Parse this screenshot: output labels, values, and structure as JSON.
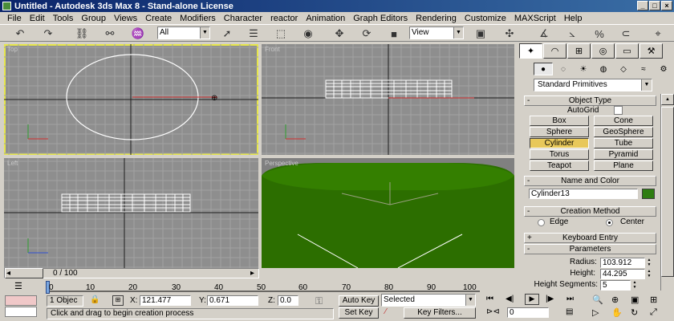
{
  "window": {
    "title": "Untitled - Autodesk 3ds Max 8  - Stand-alone License",
    "min": "_",
    "max": "□",
    "close": "×"
  },
  "menu": [
    "File",
    "Edit",
    "Tools",
    "Group",
    "Views",
    "Create",
    "Modifiers",
    "Character",
    "reactor",
    "Animation",
    "Graph Editors",
    "Rendering",
    "Customize",
    "MAXScript",
    "Help"
  ],
  "toolbar": {
    "selection_filter": "All",
    "ref_coord": "View"
  },
  "viewports": {
    "top": {
      "label": "Top"
    },
    "front": {
      "label": "Front"
    },
    "left": {
      "label": "Left"
    },
    "perspective": {
      "label": "Perspective"
    },
    "colors": {
      "grid_bg": "#8e8e8e",
      "grid_line": "#a2a2a2",
      "axis": "#1e1e1e",
      "wire": "#ffffff",
      "cylinder": "#2c6e00",
      "active_border": "#e6e64a"
    }
  },
  "command_panel": {
    "category": "Standard Primitives",
    "object_type": {
      "title": "Object Type",
      "autogrid": "AutoGrid",
      "buttons": [
        "Box",
        "Cone",
        "Sphere",
        "GeoSphere",
        "Cylinder",
        "Tube",
        "Torus",
        "Pyramid",
        "Teapot",
        "Plane"
      ],
      "active": "Cylinder"
    },
    "name_color": {
      "title": "Name and Color",
      "name": "Cylinder13",
      "color": "#2e7d10"
    },
    "creation_method": {
      "title": "Creation Method",
      "edge": "Edge",
      "center": "Center",
      "selected": "Center"
    },
    "keyboard_entry": {
      "title": "Keyboard Entry"
    },
    "parameters": {
      "title": "Parameters",
      "radius_label": "Radius:",
      "radius": "103.912",
      "height_label": "Height:",
      "height": "44.295",
      "hsegs_label": "Height Segments:",
      "hsegs": "5"
    }
  },
  "timeline": {
    "slider_text": "0 / 100",
    "ticks": [
      "0",
      "10",
      "20",
      "30",
      "40",
      "50",
      "60",
      "70",
      "80",
      "90",
      "100"
    ]
  },
  "status": {
    "selection_count": "1 Objec",
    "x_label": "X:",
    "x": "121.477",
    "y_label": "Y:",
    "y": "0.671",
    "z_label": "Z:",
    "z": "0.0",
    "prompt": "Click and drag to begin creation process",
    "auto_key": "Auto Key",
    "set_key": "Set Key",
    "key_mode": "Selected",
    "key_filters": "Key Filters...",
    "frame": "0"
  }
}
